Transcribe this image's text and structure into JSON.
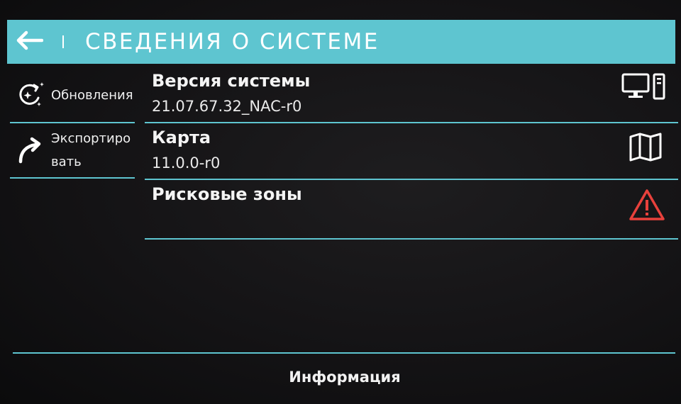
{
  "header": {
    "back_icon": "arrow-left-icon",
    "title": "СВЕДЕНИЯ О СИСТЕМЕ",
    "background_color": "#5ec5d0"
  },
  "sidebar": {
    "items": [
      {
        "label": "Обновления",
        "icon": "update-sparkle-icon"
      },
      {
        "label": "Экспортировать",
        "icon": "export-arrow-icon"
      }
    ]
  },
  "main": {
    "rows": [
      {
        "title": "Версия системы",
        "value": "21.07.67.32_NAC-r0",
        "icon": "computer-tower-icon"
      },
      {
        "title": "Карта",
        "value": "11.0.0-r0",
        "icon": "map-icon"
      },
      {
        "title": "Рисковые зоны",
        "value": "",
        "icon": "warning-triangle-icon",
        "icon_color": "#e8413c"
      }
    ]
  },
  "footer": {
    "label": "Информация"
  }
}
